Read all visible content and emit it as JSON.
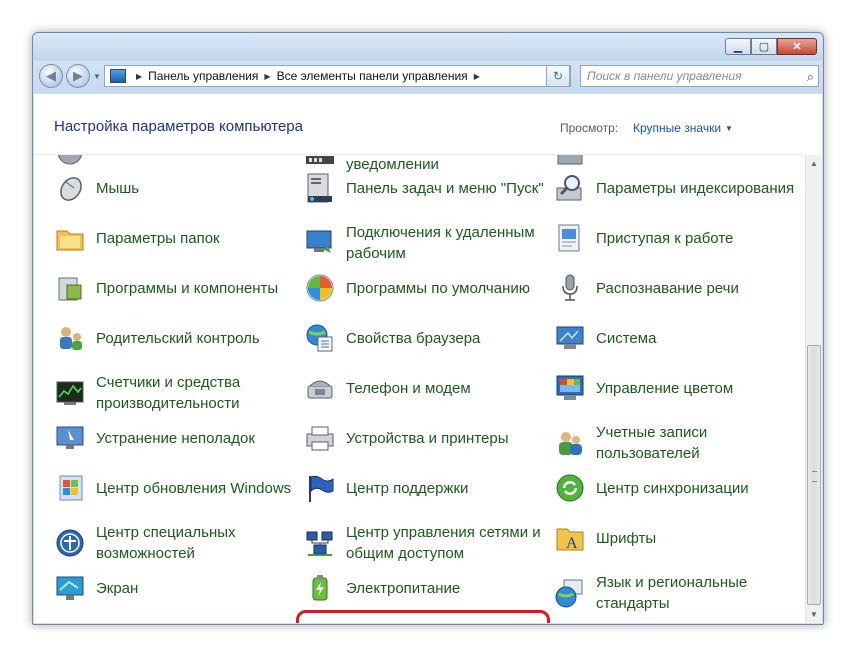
{
  "window": {
    "minimize": "▁",
    "maximize": "▢",
    "close": "✕"
  },
  "nav": {
    "back_icon": "back-arrow-icon",
    "forward_icon": "forward-arrow-icon",
    "breadcrumb": [
      "Панель управления",
      "Все элементы панели управления"
    ],
    "search_placeholder": "Поиск в панели управления"
  },
  "header": {
    "title": "Настройка параметров компьютера",
    "view_by_label": "Просмотр:",
    "view_by_value": "Крупные значки"
  },
  "columns": [
    [
      {
        "label": "Мышь",
        "icon": "mouse-icon"
      },
      {
        "label": "Параметры папок",
        "icon": "folder-options-icon"
      },
      {
        "label": "Программы и компоненты",
        "icon": "programs-features-icon"
      },
      {
        "label": "Родительский контроль",
        "icon": "parental-control-icon"
      },
      {
        "label": "Счетчики и средства производительности",
        "icon": "performance-icon"
      },
      {
        "label": "Устранение неполадок",
        "icon": "troubleshooting-icon"
      },
      {
        "label": "Центр обновления Windows",
        "icon": "windows-update-icon"
      },
      {
        "label": "Центр специальных возможностей",
        "icon": "ease-of-access-icon"
      },
      {
        "label": "Экран",
        "icon": "display-icon"
      }
    ],
    [
      {
        "label": "уведомлении",
        "icon": "notification-icon",
        "partial": true
      },
      {
        "label": "Панель задач и меню \"Пуск\"",
        "icon": "taskbar-icon"
      },
      {
        "label": "Подключения к удаленным рабочим",
        "icon": "remote-desktop-icon"
      },
      {
        "label": "Программы по умолчанию",
        "icon": "default-programs-icon"
      },
      {
        "label": "Свойства браузера",
        "icon": "internet-options-icon"
      },
      {
        "label": "Телефон и модем",
        "icon": "phone-modem-icon"
      },
      {
        "label": "Устройства и принтеры",
        "icon": "devices-printers-icon"
      },
      {
        "label": "Центр поддержки",
        "icon": "action-center-flag-icon"
      },
      {
        "label": "Центр управления сетями и общим доступом",
        "icon": "network-center-icon"
      },
      {
        "label": "Электропитание",
        "icon": "power-options-icon"
      }
    ],
    [
      {
        "label": "Параметры индексирования",
        "icon": "indexing-icon"
      },
      {
        "label": "Приступая к работе",
        "icon": "getting-started-icon"
      },
      {
        "label": "Распознавание речи",
        "icon": "microphone-icon"
      },
      {
        "label": "Система",
        "icon": "system-icon"
      },
      {
        "label": "Управление цветом",
        "icon": "color-management-icon"
      },
      {
        "label": "Учетные записи пользователей",
        "icon": "user-accounts-icon"
      },
      {
        "label": "Центр синхронизации",
        "icon": "sync-center-icon"
      },
      {
        "label": "Шрифты",
        "icon": "fonts-icon"
      },
      {
        "label": "Язык и региональные стандарты",
        "icon": "region-language-icon"
      }
    ]
  ],
  "colors": {
    "link_green": "#1c5a1c",
    "header_blue": "#1e3287",
    "highlight_red": "#e3141a"
  }
}
